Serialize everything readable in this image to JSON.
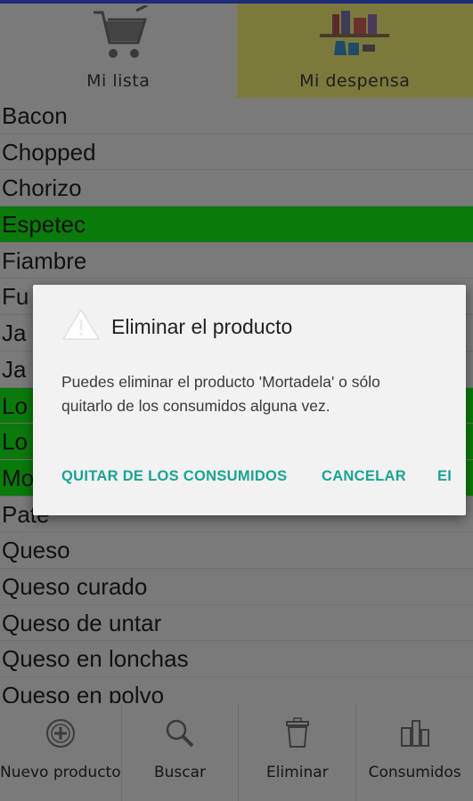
{
  "colors": {
    "accent": "#1aa394",
    "highlight_green": "#0a7a0a",
    "active_tab": "#7b7a3c",
    "topbar": "#1f2a7a"
  },
  "tabs": [
    {
      "label": "Mi lista",
      "icon": "shopping-cart-icon",
      "active": false
    },
    {
      "label": "Mi despensa",
      "icon": "pantry-shelf-icon",
      "active": true
    }
  ],
  "products": [
    {
      "name": "Bacon",
      "consumed": false
    },
    {
      "name": "Chopped",
      "consumed": false
    },
    {
      "name": "Chorizo",
      "consumed": false
    },
    {
      "name": "Espetec",
      "consumed": true
    },
    {
      "name": "Fiambre",
      "consumed": false
    },
    {
      "name": "Fu",
      "consumed": false
    },
    {
      "name": "Ja",
      "consumed": false
    },
    {
      "name": "Ja",
      "consumed": false
    },
    {
      "name": "Lo",
      "consumed": true
    },
    {
      "name": "Lo",
      "consumed": true
    },
    {
      "name": "Mo",
      "consumed": true
    },
    {
      "name": "Pate",
      "consumed": false
    },
    {
      "name": "Queso",
      "consumed": false
    },
    {
      "name": "Queso curado",
      "consumed": false
    },
    {
      "name": "Queso de untar",
      "consumed": false
    },
    {
      "name": "Queso en lonchas",
      "consumed": false
    },
    {
      "name": "Queso en polvo",
      "consumed": false
    }
  ],
  "dialog": {
    "title": "Eliminar el producto",
    "icon": "warning-icon",
    "message": "Puedes eliminar el producto 'Mortadela' o sólo quitarlo de los consumidos alguna vez.",
    "actions": {
      "remove_consumed": "QUITAR DE LOS CONSUMIDOS",
      "cancel": "CANCELAR",
      "delete": "EI"
    }
  },
  "bottom_nav": [
    {
      "label": "Nuevo producto",
      "icon": "add-circle-icon"
    },
    {
      "label": "Buscar",
      "icon": "magnifier-icon"
    },
    {
      "label": "Eliminar",
      "icon": "trash-icon"
    },
    {
      "label": "Consumidos",
      "icon": "consumed-icon"
    }
  ]
}
